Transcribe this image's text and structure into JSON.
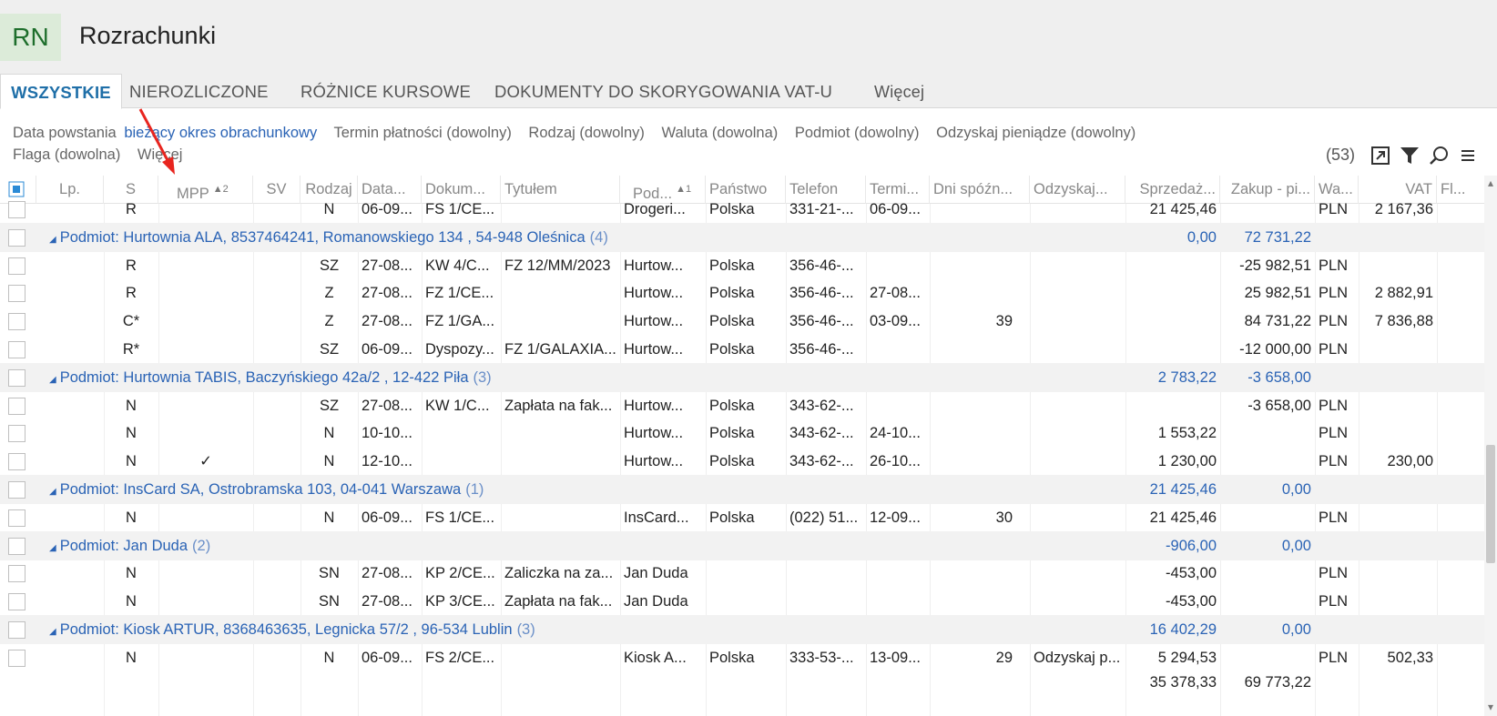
{
  "app": {
    "logo": "RN",
    "title": "Rozrachunki"
  },
  "tabs": [
    {
      "label": "WSZYSTKIE",
      "active": true
    },
    {
      "label": "NIEROZLICZONE"
    },
    {
      "label": "RÓŻNICE KURSOWE"
    },
    {
      "label": "DOKUMENTY DO SKORYGOWANIA VAT-U"
    },
    {
      "label": "Więcej"
    }
  ],
  "filters": {
    "date_label": "Data powstania",
    "date_value": "bieżący okres obrachunkowy",
    "payment": "Termin płatności (dowolny)",
    "kind": "Rodzaj (dowolny)",
    "currency": "Waluta (dowolna)",
    "subject": "Podmiot (dowolny)",
    "recover": "Odzyskaj pieniądze (dowolny)",
    "flag": "Flaga (dowolna)",
    "more": "Więcej"
  },
  "toolbar": {
    "count": "(53)",
    "icons": [
      "expand-icon",
      "filter-icon",
      "search-icon",
      "menu-icon"
    ]
  },
  "columns": {
    "lp": "Lp.",
    "s": "S",
    "mpp": "MPP",
    "mpp_sort": "2",
    "sv": "SV",
    "rodzaj": "Rodzaj",
    "data": "Data...",
    "dokument": "Dokum...",
    "tytul": "Tytułem",
    "podmiot": "Pod...",
    "podmiot_sort": "1",
    "panstwo": "Państwo",
    "telefon": "Telefon",
    "termin": "Termi...",
    "dni": "Dni spóźn...",
    "odzyskaj": "Odzyskaj...",
    "sprzedaz": "Sprzedaż...",
    "zakup": "Zakup - pi...",
    "waluta": "Wa...",
    "vat": "VAT",
    "flaga": "Fl..."
  },
  "rows": [
    {
      "type": "item",
      "s": "R",
      "rodzaj": "N",
      "data": "06-09...",
      "dokument": "FS 1/CE...",
      "tytul": "",
      "podmiot": "Drogeri...",
      "panstwo": "Polska",
      "telefon": "331-21-...",
      "termin": "06-09...",
      "dni": "",
      "odzyskaj": "",
      "sprzedaz": "21 425,46",
      "zakup": "",
      "waluta": "PLN",
      "vat": "2 167,36",
      "partial": true
    },
    {
      "type": "group",
      "label": "Podmiot: Hurtownia ALA, 8537464241, Romanowskiego 134 , 54-948 Oleśnica",
      "count": "(4)",
      "sprzedaz": "0,00",
      "zakup": "72 731,22"
    },
    {
      "type": "item",
      "s": "R",
      "rodzaj": "SZ",
      "data": "27-08...",
      "dokument": "KW 4/C...",
      "tytul": "FZ 12/MM/2023",
      "podmiot": "Hurtow...",
      "panstwo": "Polska",
      "telefon": "356-46-...",
      "termin": "",
      "dni": "",
      "odzyskaj": "",
      "sprzedaz": "",
      "zakup": "-25 982,51",
      "waluta": "PLN",
      "vat": ""
    },
    {
      "type": "item",
      "s": "R",
      "rodzaj": "Z",
      "data": "27-08...",
      "dokument": "FZ 1/CE...",
      "tytul": "",
      "podmiot": "Hurtow...",
      "panstwo": "Polska",
      "telefon": "356-46-...",
      "termin": "27-08...",
      "dni": "",
      "odzyskaj": "",
      "sprzedaz": "",
      "zakup": "25 982,51",
      "waluta": "PLN",
      "vat": "2 882,91"
    },
    {
      "type": "item",
      "s": "C*",
      "rodzaj": "Z",
      "data": "27-08...",
      "dokument": "FZ 1/GA...",
      "tytul": "",
      "podmiot": "Hurtow...",
      "panstwo": "Polska",
      "telefon": "356-46-...",
      "termin": "03-09...",
      "dni": "39",
      "odzyskaj": "",
      "sprzedaz": "",
      "zakup": "84 731,22",
      "waluta": "PLN",
      "vat": "7 836,88"
    },
    {
      "type": "item",
      "s": "R*",
      "rodzaj": "SZ",
      "data": "06-09...",
      "dokument": "Dyspozy...",
      "tytul": "FZ 1/GALAXIA...",
      "podmiot": "Hurtow...",
      "panstwo": "Polska",
      "telefon": "356-46-...",
      "termin": "",
      "dni": "",
      "odzyskaj": "",
      "sprzedaz": "",
      "zakup": "-12 000,00",
      "waluta": "PLN",
      "vat": ""
    },
    {
      "type": "group",
      "label": "Podmiot: Hurtownia TABIS, Baczyńskiego  42a/2 , 12-422 Piła",
      "count": "(3)",
      "sprzedaz": "2 783,22",
      "zakup": "-3 658,00"
    },
    {
      "type": "item",
      "s": "N",
      "rodzaj": "SZ",
      "data": "27-08...",
      "dokument": "KW 1/C...",
      "tytul": "Zapłata na fak...",
      "podmiot": "Hurtow...",
      "panstwo": "Polska",
      "telefon": "343-62-...",
      "termin": "",
      "dni": "",
      "odzyskaj": "",
      "sprzedaz": "",
      "zakup": "-3 658,00",
      "waluta": "PLN",
      "vat": ""
    },
    {
      "type": "item",
      "s": "N",
      "rodzaj": "N",
      "data": "10-10...",
      "dokument": "",
      "tytul": "",
      "podmiot": "Hurtow...",
      "panstwo": "Polska",
      "telefon": "343-62-...",
      "termin": "24-10...",
      "dni": "",
      "odzyskaj": "",
      "sprzedaz": "1 553,22",
      "zakup": "",
      "waluta": "PLN",
      "vat": ""
    },
    {
      "type": "item",
      "s": "N",
      "mpp": "✓",
      "rodzaj": "N",
      "data": "12-10...",
      "dokument": "",
      "tytul": "",
      "podmiot": "Hurtow...",
      "panstwo": "Polska",
      "telefon": "343-62-...",
      "termin": "26-10...",
      "dni": "",
      "odzyskaj": "",
      "sprzedaz": "1 230,00",
      "zakup": "",
      "waluta": "PLN",
      "vat": "230,00"
    },
    {
      "type": "group",
      "label": "Podmiot: InsCard SA, Ostrobramska 103, 04-041 Warszawa",
      "count": "(1)",
      "sprzedaz": "21 425,46",
      "zakup": "0,00"
    },
    {
      "type": "item",
      "s": "N",
      "rodzaj": "N",
      "data": "06-09...",
      "dokument": "FS 1/CE...",
      "tytul": "",
      "podmiot": "InsCard...",
      "panstwo": "Polska",
      "telefon": "(022) 51...",
      "termin": "12-09...",
      "dni": "30",
      "odzyskaj": "",
      "sprzedaz": "21 425,46",
      "zakup": "",
      "waluta": "PLN",
      "vat": ""
    },
    {
      "type": "group",
      "label": "Podmiot: Jan Duda",
      "count": "(2)",
      "sprzedaz": "-906,00",
      "zakup": "0,00"
    },
    {
      "type": "item",
      "s": "N",
      "rodzaj": "SN",
      "data": "27-08...",
      "dokument": "KP 2/CE...",
      "tytul": "Zaliczka na za...",
      "podmiot": "Jan Duda",
      "panstwo": "",
      "telefon": "",
      "termin": "",
      "dni": "",
      "odzyskaj": "",
      "sprzedaz": "-453,00",
      "zakup": "",
      "waluta": "PLN",
      "vat": ""
    },
    {
      "type": "item",
      "s": "N",
      "rodzaj": "SN",
      "data": "27-08...",
      "dokument": "KP 3/CE...",
      "tytul": "Zapłata na fak...",
      "podmiot": "Jan Duda",
      "panstwo": "",
      "telefon": "",
      "termin": "",
      "dni": "",
      "odzyskaj": "",
      "sprzedaz": "-453,00",
      "zakup": "",
      "waluta": "PLN",
      "vat": ""
    },
    {
      "type": "group",
      "label": "Podmiot: Kiosk ARTUR, 8368463635, Legnicka  57/2 , 96-534 Lublin",
      "count": "(3)",
      "sprzedaz": "16 402,29",
      "zakup": "0,00"
    },
    {
      "type": "item",
      "s": "N",
      "rodzaj": "N",
      "data": "06-09...",
      "dokument": "FS 2/CE...",
      "tytul": "",
      "podmiot": "Kiosk A...",
      "panstwo": "Polska",
      "telefon": "333-53-...",
      "termin": "13-09...",
      "dni": "29",
      "odzyskaj": "Odzyskaj p...",
      "sprzedaz": "5 294,53",
      "zakup": "",
      "waluta": "PLN",
      "vat": "502,33"
    }
  ],
  "totals": {
    "sprzedaz": "35 378,33",
    "zakup": "69 773,22"
  },
  "colors": {
    "accent": "#1f6fa8",
    "link": "#2a63b5",
    "annotation_arrow": "#e8251f",
    "logo_bg": "#dcebd9",
    "logo_fg": "#1e6e2c"
  }
}
